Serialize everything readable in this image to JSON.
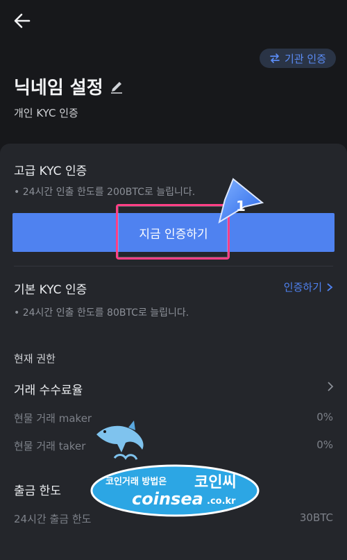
{
  "nav": {
    "back_icon": "arrow-left-icon"
  },
  "header": {
    "institution_label": "기관 인증",
    "title": "닉네임 설정",
    "subtitle": "개인 KYC 인증"
  },
  "advanced_kyc": {
    "title": "고급 KYC 인증",
    "note": "• 24시간 인출 한도를 200BTC로 늘립니다.",
    "cta": "지금 인증하기",
    "step_badge": "1"
  },
  "basic_kyc": {
    "title": "기본 KYC 인증",
    "link": "인증하기",
    "note": "• 24시간 인출 한도를 80BTC로 늘립니다."
  },
  "permissions": {
    "section_title": "현재 권한",
    "fee_title": "거래 수수료율",
    "rows": [
      {
        "label": "현물 거래 maker",
        "value": "0%"
      },
      {
        "label": "현물 거래 taker",
        "value": "0%"
      }
    ]
  },
  "withdrawal": {
    "title": "출금 한도",
    "rows": [
      {
        "label": "24시간 출금 한도",
        "value": "30BTC"
      }
    ]
  },
  "watermark": {
    "line1a": "코인거래 방법은",
    "line1b": "코인씨",
    "line2": "coinsea",
    "line2_suffix": ".co.kr"
  },
  "colors": {
    "accent": "#4f82f0",
    "highlight": "#ff3f86",
    "background": "#17181b",
    "card": "#24262b"
  }
}
